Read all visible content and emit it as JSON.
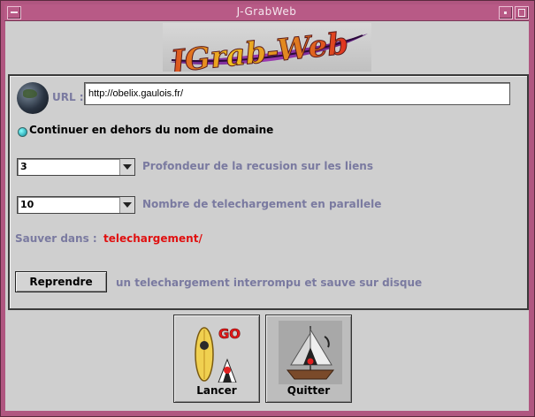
{
  "window": {
    "title": "J-GrabWeb"
  },
  "banner": {
    "text": "JGrab-Web"
  },
  "url": {
    "label": "URL :",
    "value": "http://obelix.gaulois.fr/"
  },
  "option": {
    "label": "Continuer en dehors du nom de domaine",
    "checked": true
  },
  "depth": {
    "value": "3",
    "description": "Profondeur de la recusion sur les liens"
  },
  "parallel": {
    "value": "10",
    "description": "Nombre de telechargement en parallele"
  },
  "save": {
    "label": "Sauver dans :",
    "value": "telechargement/"
  },
  "resume": {
    "button": "Reprendre",
    "description": "un telechargement interrompu et sauve sur disque"
  },
  "actions": {
    "launch": "Lancer",
    "launch_badge": "GO",
    "quit": "Quitter"
  },
  "colors": {
    "frame": "#b05680",
    "label": "#7a7aa0",
    "path": "#e01010"
  }
}
